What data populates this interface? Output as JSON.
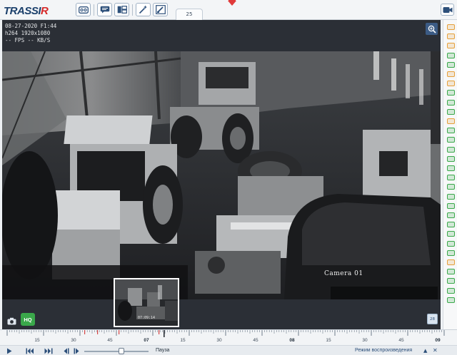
{
  "app": {
    "logo_main": "TRASSI",
    "logo_accent": "R",
    "tab_label": "25"
  },
  "toolbar": {
    "buttons": [
      {
        "name": "tape-button",
        "icon": "tape-icon"
      },
      {
        "name": "chat-button",
        "icon": "chat-icon"
      },
      {
        "name": "layout-button",
        "icon": "layout-icon"
      },
      {
        "name": "wand-button",
        "icon": "wand-icon"
      },
      {
        "name": "edit-layout-button",
        "icon": "edit-icon"
      }
    ],
    "camera_button_icon": "video-camera-icon"
  },
  "video": {
    "osd_line1": "08-27-2020 F1:44",
    "osd_line2": "h264 1920x1080",
    "osd_line3": "-- FPS -- KB/S",
    "camera_name": "Camera 01",
    "thumbnail_time": "07:09:14",
    "hq_label": "HQ",
    "calendar_label": "28"
  },
  "sidebar": {
    "icons": [
      {
        "color": "#e5a03a"
      },
      {
        "color": "#e5a03a"
      },
      {
        "color": "#e5a03a"
      },
      {
        "color": "#3aa84a"
      },
      {
        "color": "#3aa84a"
      },
      {
        "color": "#e5a03a"
      },
      {
        "color": "#e5a03a"
      },
      {
        "color": "#3aa84a"
      },
      {
        "color": "#3aa84a"
      },
      {
        "color": "#3aa84a"
      },
      {
        "color": "#e5a03a"
      },
      {
        "color": "#3aa84a"
      },
      {
        "color": "#3aa84a"
      },
      {
        "color": "#3aa84a"
      },
      {
        "color": "#3aa84a"
      },
      {
        "color": "#3aa84a"
      },
      {
        "color": "#3aa84a"
      },
      {
        "color": "#3aa84a"
      },
      {
        "color": "#3aa84a"
      },
      {
        "color": "#3aa84a"
      },
      {
        "color": "#3aa84a"
      },
      {
        "color": "#3aa84a"
      },
      {
        "color": "#3aa84a"
      },
      {
        "color": "#3aa84a"
      },
      {
        "color": "#3aa84a"
      },
      {
        "color": "#e5a03a"
      },
      {
        "color": "#3aa84a"
      },
      {
        "color": "#3aa84a"
      },
      {
        "color": "#3aa84a"
      },
      {
        "color": "#3aa84a"
      }
    ]
  },
  "timeline": {
    "labels": [
      "15",
      "30",
      "45",
      "07",
      "15",
      "30",
      "45",
      "08",
      "15",
      "30",
      "45",
      "09"
    ],
    "pause_label": "Пауза",
    "mode_label": "Режим воспроизведения",
    "mode_arrow": "▲",
    "close_label": "✕"
  }
}
